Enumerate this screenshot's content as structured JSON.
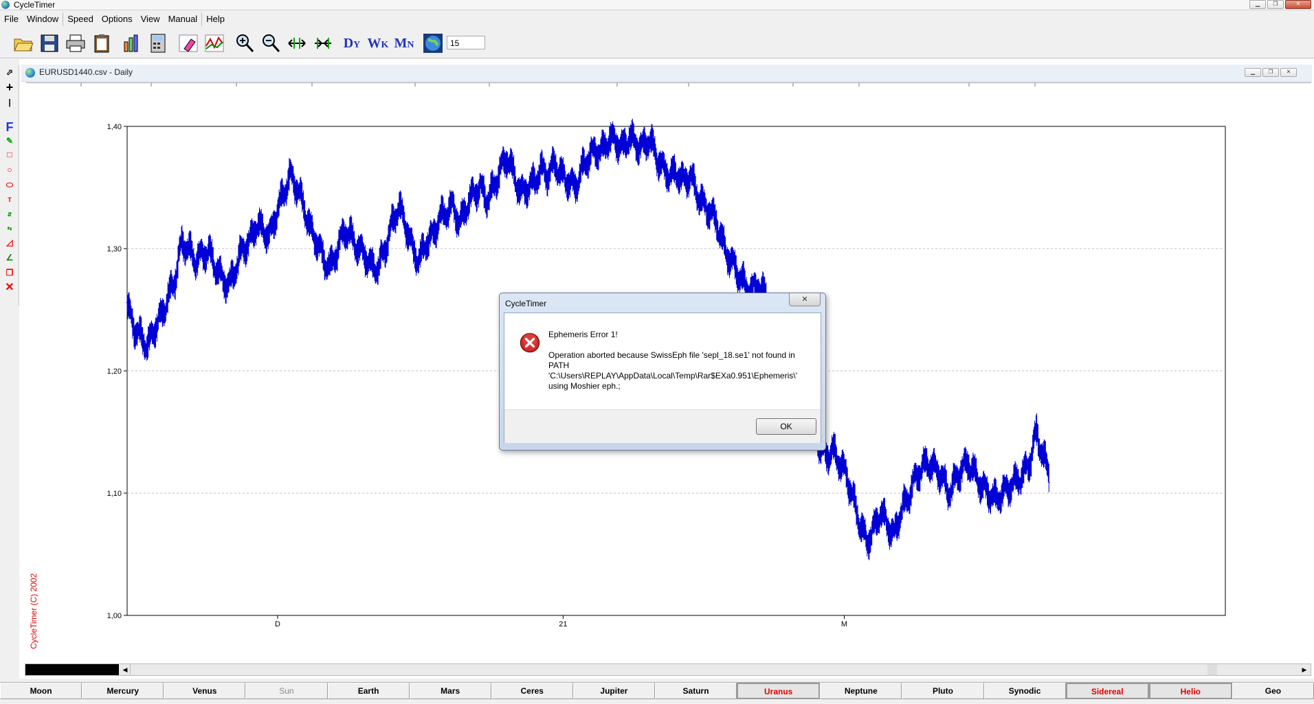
{
  "app": {
    "title": "CycleTimer"
  },
  "menu": [
    "File",
    "Window",
    "Speed",
    "Options",
    "View",
    "Manual",
    "Help"
  ],
  "toolbar": {
    "buttons": [
      "open-folder",
      "save-disk",
      "print",
      "clipboard",
      "bar-chart",
      "calculator",
      "eraser",
      "chart-wave",
      "zoom-in",
      "zoom-out",
      "expand-horizontal",
      "compress-horizontal",
      "daily-dy",
      "weekly-wk",
      "monthly-mn",
      "globe"
    ],
    "zoom_value": "15"
  },
  "toolbox": [
    "pointer",
    "crosshair",
    "vertical-line",
    "F",
    "pencil",
    "rectangle",
    "circle",
    "ellipse",
    "text",
    "price",
    "time",
    "pivot",
    "gann",
    "copy",
    "delete"
  ],
  "child_window": {
    "title": "EURUSD1440.csv - Daily"
  },
  "chart_data": {
    "type": "line",
    "title": "",
    "xlabel": "",
    "ylabel": "",
    "ylim": [
      1.0,
      1.4
    ],
    "yticks": [
      "1,40",
      "1,30",
      "1,20",
      "1,10",
      "1,00"
    ],
    "x_markers": [
      {
        "label": "D",
        "pos": 0.137
      },
      {
        "label": "21",
        "pos": 0.397
      },
      {
        "label": "M",
        "pos": 0.653
      }
    ],
    "grid": "horizontal dashed",
    "series": [
      {
        "color": "#0000d6",
        "x_end": 0.84,
        "values": [
          1.252,
          1.235,
          1.228,
          1.22,
          1.235,
          1.245,
          1.26,
          1.275,
          1.305,
          1.3,
          1.29,
          1.295,
          1.298,
          1.285,
          1.275,
          1.27,
          1.285,
          1.3,
          1.305,
          1.32,
          1.315,
          1.31,
          1.33,
          1.345,
          1.36,
          1.35,
          1.335,
          1.315,
          1.305,
          1.29,
          1.285,
          1.3,
          1.315,
          1.31,
          1.3,
          1.295,
          1.285,
          1.285,
          1.3,
          1.32,
          1.335,
          1.32,
          1.3,
          1.29,
          1.305,
          1.31,
          1.325,
          1.33,
          1.335,
          1.32,
          1.335,
          1.345,
          1.35,
          1.34,
          1.35,
          1.365,
          1.375,
          1.36,
          1.345,
          1.35,
          1.355,
          1.365,
          1.36,
          1.37,
          1.36,
          1.355,
          1.35,
          1.365,
          1.375,
          1.38,
          1.38,
          1.39,
          1.388,
          1.382,
          1.392,
          1.385,
          1.383,
          1.39,
          1.375,
          1.365,
          1.36,
          1.362,
          1.355,
          1.36,
          1.345,
          1.335,
          1.33,
          1.32,
          1.3,
          1.29,
          1.28,
          1.27,
          1.265,
          1.27,
          1.262,
          1.245,
          1.235,
          1.225,
          1.215,
          1.2,
          1.18,
          1.16,
          1.14,
          1.13,
          1.135,
          1.125,
          1.115,
          1.095,
          1.075,
          1.06,
          1.07,
          1.085,
          1.075,
          1.065,
          1.085,
          1.095,
          1.11,
          1.12,
          1.125,
          1.12,
          1.115,
          1.1,
          1.11,
          1.12,
          1.125,
          1.115,
          1.105,
          1.1,
          1.095,
          1.1,
          1.105,
          1.11,
          1.115,
          1.125,
          1.15,
          1.13,
          1.115
        ]
      }
    ]
  },
  "copyright": "CycleTimer (C) 2002",
  "planets": [
    "Moon",
    "Mercury",
    "Venus",
    "Sun",
    "Earth",
    "Mars",
    "Ceres",
    "Jupiter",
    "Saturn",
    "Uranus",
    "Neptune",
    "Pluto",
    "Synodic",
    "Sidereal",
    "Helio",
    "Geo"
  ],
  "planets_disabled": [
    "Sun"
  ],
  "planets_active": [
    "Uranus",
    "Sidereal",
    "Helio"
  ],
  "dialog": {
    "title": "CycleTimer",
    "close": "✕",
    "heading": "Ephemeris Error 1!",
    "line1": "Operation aborted because SwissEph file 'sepl_18.se1' not found in",
    "line2": "PATH",
    "line3": "'C:\\Users\\REPLAY\\AppData\\Local\\Temp\\Rar$EXa0.951\\Ephemeris\\'",
    "line4": "using Moshier eph.;",
    "ok": "OK"
  }
}
